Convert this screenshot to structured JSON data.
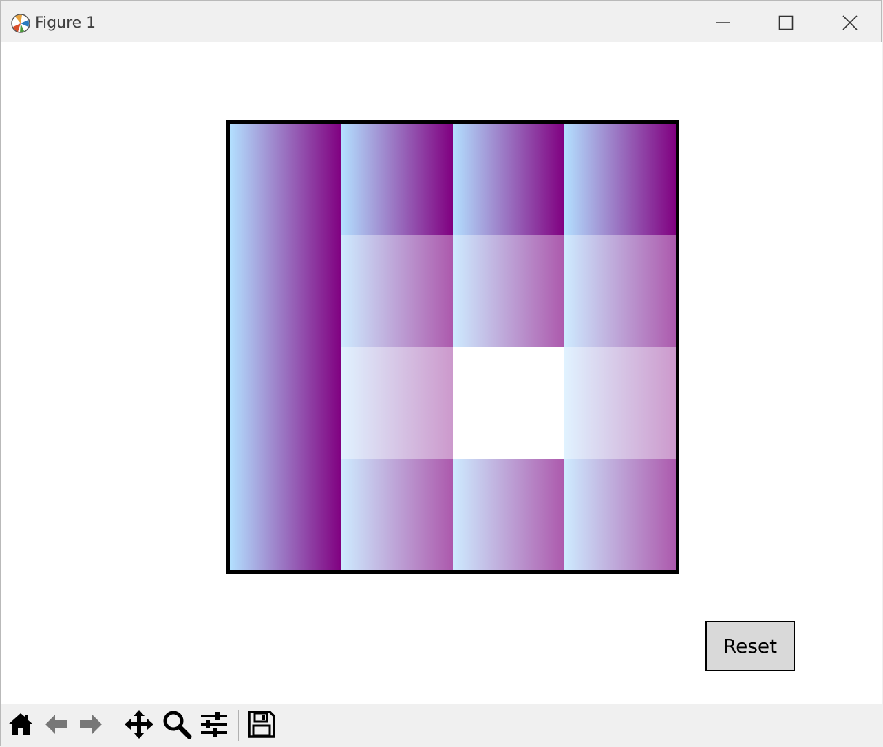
{
  "window": {
    "title": "Figure 1",
    "icons": {
      "app": "matplotlib-icon",
      "minimize": "minimize-icon",
      "maximize": "maximize-icon",
      "close": "close-icon"
    }
  },
  "grid": {
    "rows": 4,
    "cols": 4,
    "empty_tile": {
      "row": 2,
      "col": 1
    },
    "merged_column_tile": {
      "col": 0
    },
    "gradient_start_color": "#b3e0ff",
    "gradient_end_color": "#800080",
    "tile_opacity_by_row": [
      1.0,
      0.65,
      0.4,
      0.65
    ]
  },
  "reset_button": {
    "label": "Reset"
  },
  "toolbar": {
    "tools": [
      {
        "name": "home-icon"
      },
      {
        "name": "back-icon"
      },
      {
        "name": "forward-icon"
      },
      {
        "name": "pan-icon"
      },
      {
        "name": "zoom-icon"
      },
      {
        "name": "configure-subplots-icon"
      },
      {
        "name": "save-icon"
      }
    ]
  }
}
